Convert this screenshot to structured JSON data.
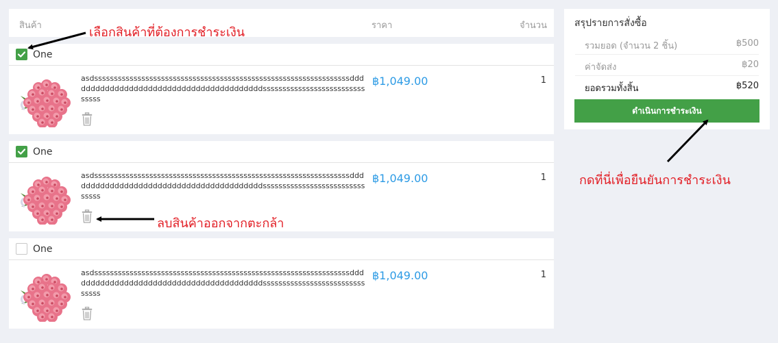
{
  "header": {
    "product_label": "สินค้า",
    "price_label": "ราคา",
    "qty_label": "จำนวน"
  },
  "items": [
    {
      "shop": "One",
      "checked": true,
      "description": "asdsssssssssssssssssssssssssssssssssssssssssssssssssssssssssssssssssdddddddddddddddddddddddddddddddddddddddddsssssssssssssssssssssssssssssss",
      "price": "฿1,049.00",
      "qty": "1"
    },
    {
      "shop": "One",
      "checked": true,
      "description": "asdsssssssssssssssssssssssssssssssssssssssssssssssssssssssssssssssssdddddddddddddddddddddddddddddddddddddddddsssssssssssssssssssssssssssssss",
      "price": "฿1,049.00",
      "qty": "1"
    },
    {
      "shop": "One",
      "checked": false,
      "description": "asdsssssssssssssssssssssssssssssssssssssssssssssssssssssssssssssssssdddddddddddddddddddddddddddddddddddddddddsssssssssssssssssssssssssssssss",
      "price": "฿1,049.00",
      "qty": "1"
    }
  ],
  "summary": {
    "title": "สรุปรายการสั่งซื้อ",
    "subtotal_label": "รวมยอด (จำนวน 2 ชิ้น)",
    "subtotal_value": "฿500",
    "shipping_label": "ค่าจัดส่ง",
    "shipping_value": "฿20",
    "total_label": "ยอดรวมทั้งสิ้น",
    "total_value": "฿520",
    "checkout_label": "ดำเนินการชำระเงิน"
  },
  "annotations": {
    "select": "เลือกสินค้าที่ต้องการชำระเงิน",
    "remove": "ลบสินค้าออกจากตะกล้า",
    "confirm": "กดที่นี่เพื่อยืนยันการชำระเงิน"
  },
  "colors": {
    "accent_green": "#43a047",
    "price_blue": "#2d9be5",
    "annotation_red": "#e21d24"
  },
  "icons": {
    "checkbox": "check-icon",
    "delete": "trash-icon",
    "product": "rose-bouquet-image"
  }
}
